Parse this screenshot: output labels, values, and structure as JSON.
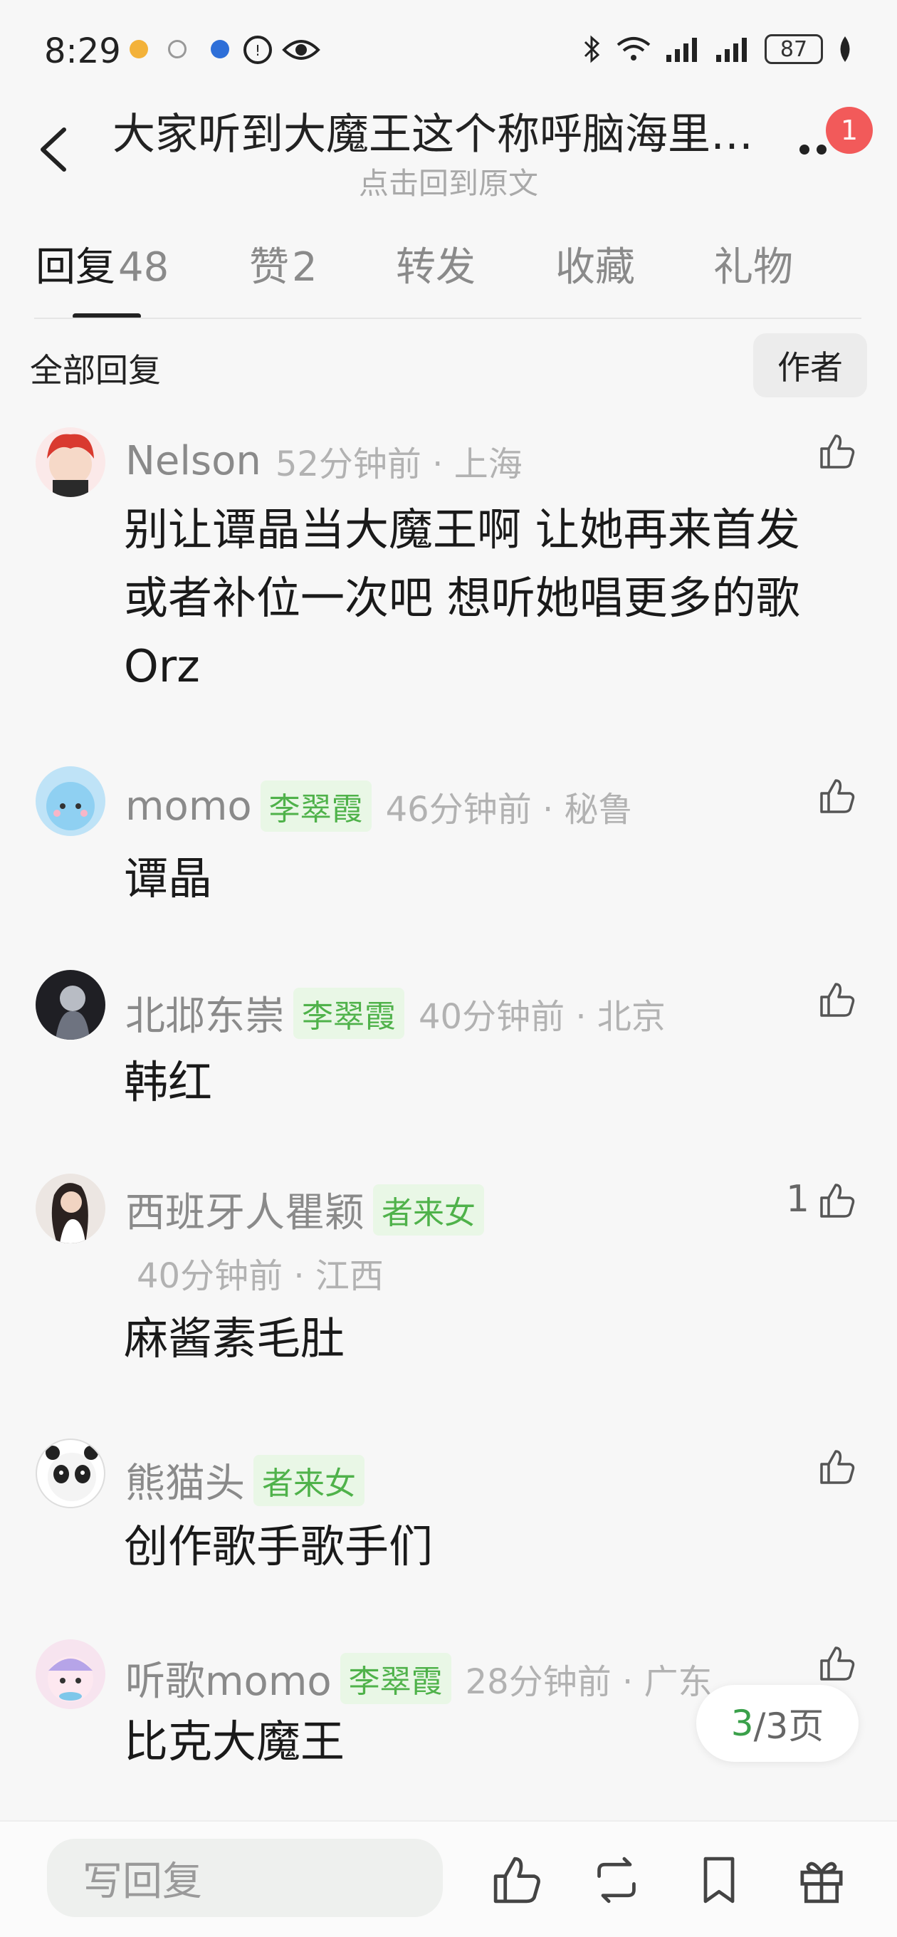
{
  "status_bar": {
    "time": "8:29",
    "battery": "87"
  },
  "header": {
    "title": "大家听到大魔王这个称呼脑海里…",
    "subtitle": "点击回到原文",
    "notification_count": "1"
  },
  "tabs": [
    {
      "label": "回复",
      "count": "48"
    },
    {
      "label": "赞",
      "count": "2"
    },
    {
      "label": "转发",
      "count": ""
    },
    {
      "label": "收藏",
      "count": ""
    },
    {
      "label": "礼物",
      "count": ""
    }
  ],
  "filter": {
    "all_label": "全部回复",
    "author_label": "作者"
  },
  "comments": [
    {
      "user": "Nelson",
      "tag": "",
      "meta": "52分钟前 · 上海",
      "text_lines": [
        "别让谭晶当大魔王啊 让她再来首发",
        "或者补位一次吧 想听她唱更多的歌",
        "Orz"
      ],
      "likes": ""
    },
    {
      "user": "momo",
      "tag": "李翠霞",
      "meta": "46分钟前 · 秘鲁",
      "text_lines": [
        "谭晶"
      ],
      "likes": ""
    },
    {
      "user": "北邶东崇",
      "tag": "李翠霞",
      "meta": "40分钟前 · 北京",
      "text_lines": [
        "韩红"
      ],
      "likes": ""
    },
    {
      "user": "西班牙人瞿颖",
      "tag": "者来女",
      "meta": "40分钟前 · 江西",
      "text_lines": [
        "麻酱素毛肚"
      ],
      "likes": "1"
    },
    {
      "user": "熊猫头",
      "tag": "者来女",
      "meta": "",
      "text_lines": [
        "创作歌手歌手们"
      ],
      "likes": ""
    },
    {
      "user": "听歌momo",
      "tag": "李翠霞",
      "meta": "28分钟前 · 广东",
      "text_lines": [
        "比克大魔王"
      ],
      "likes": ""
    }
  ],
  "pagination": {
    "current": "3",
    "total_text": "/3页"
  },
  "bottom_bar": {
    "reply_placeholder": "写回复"
  }
}
